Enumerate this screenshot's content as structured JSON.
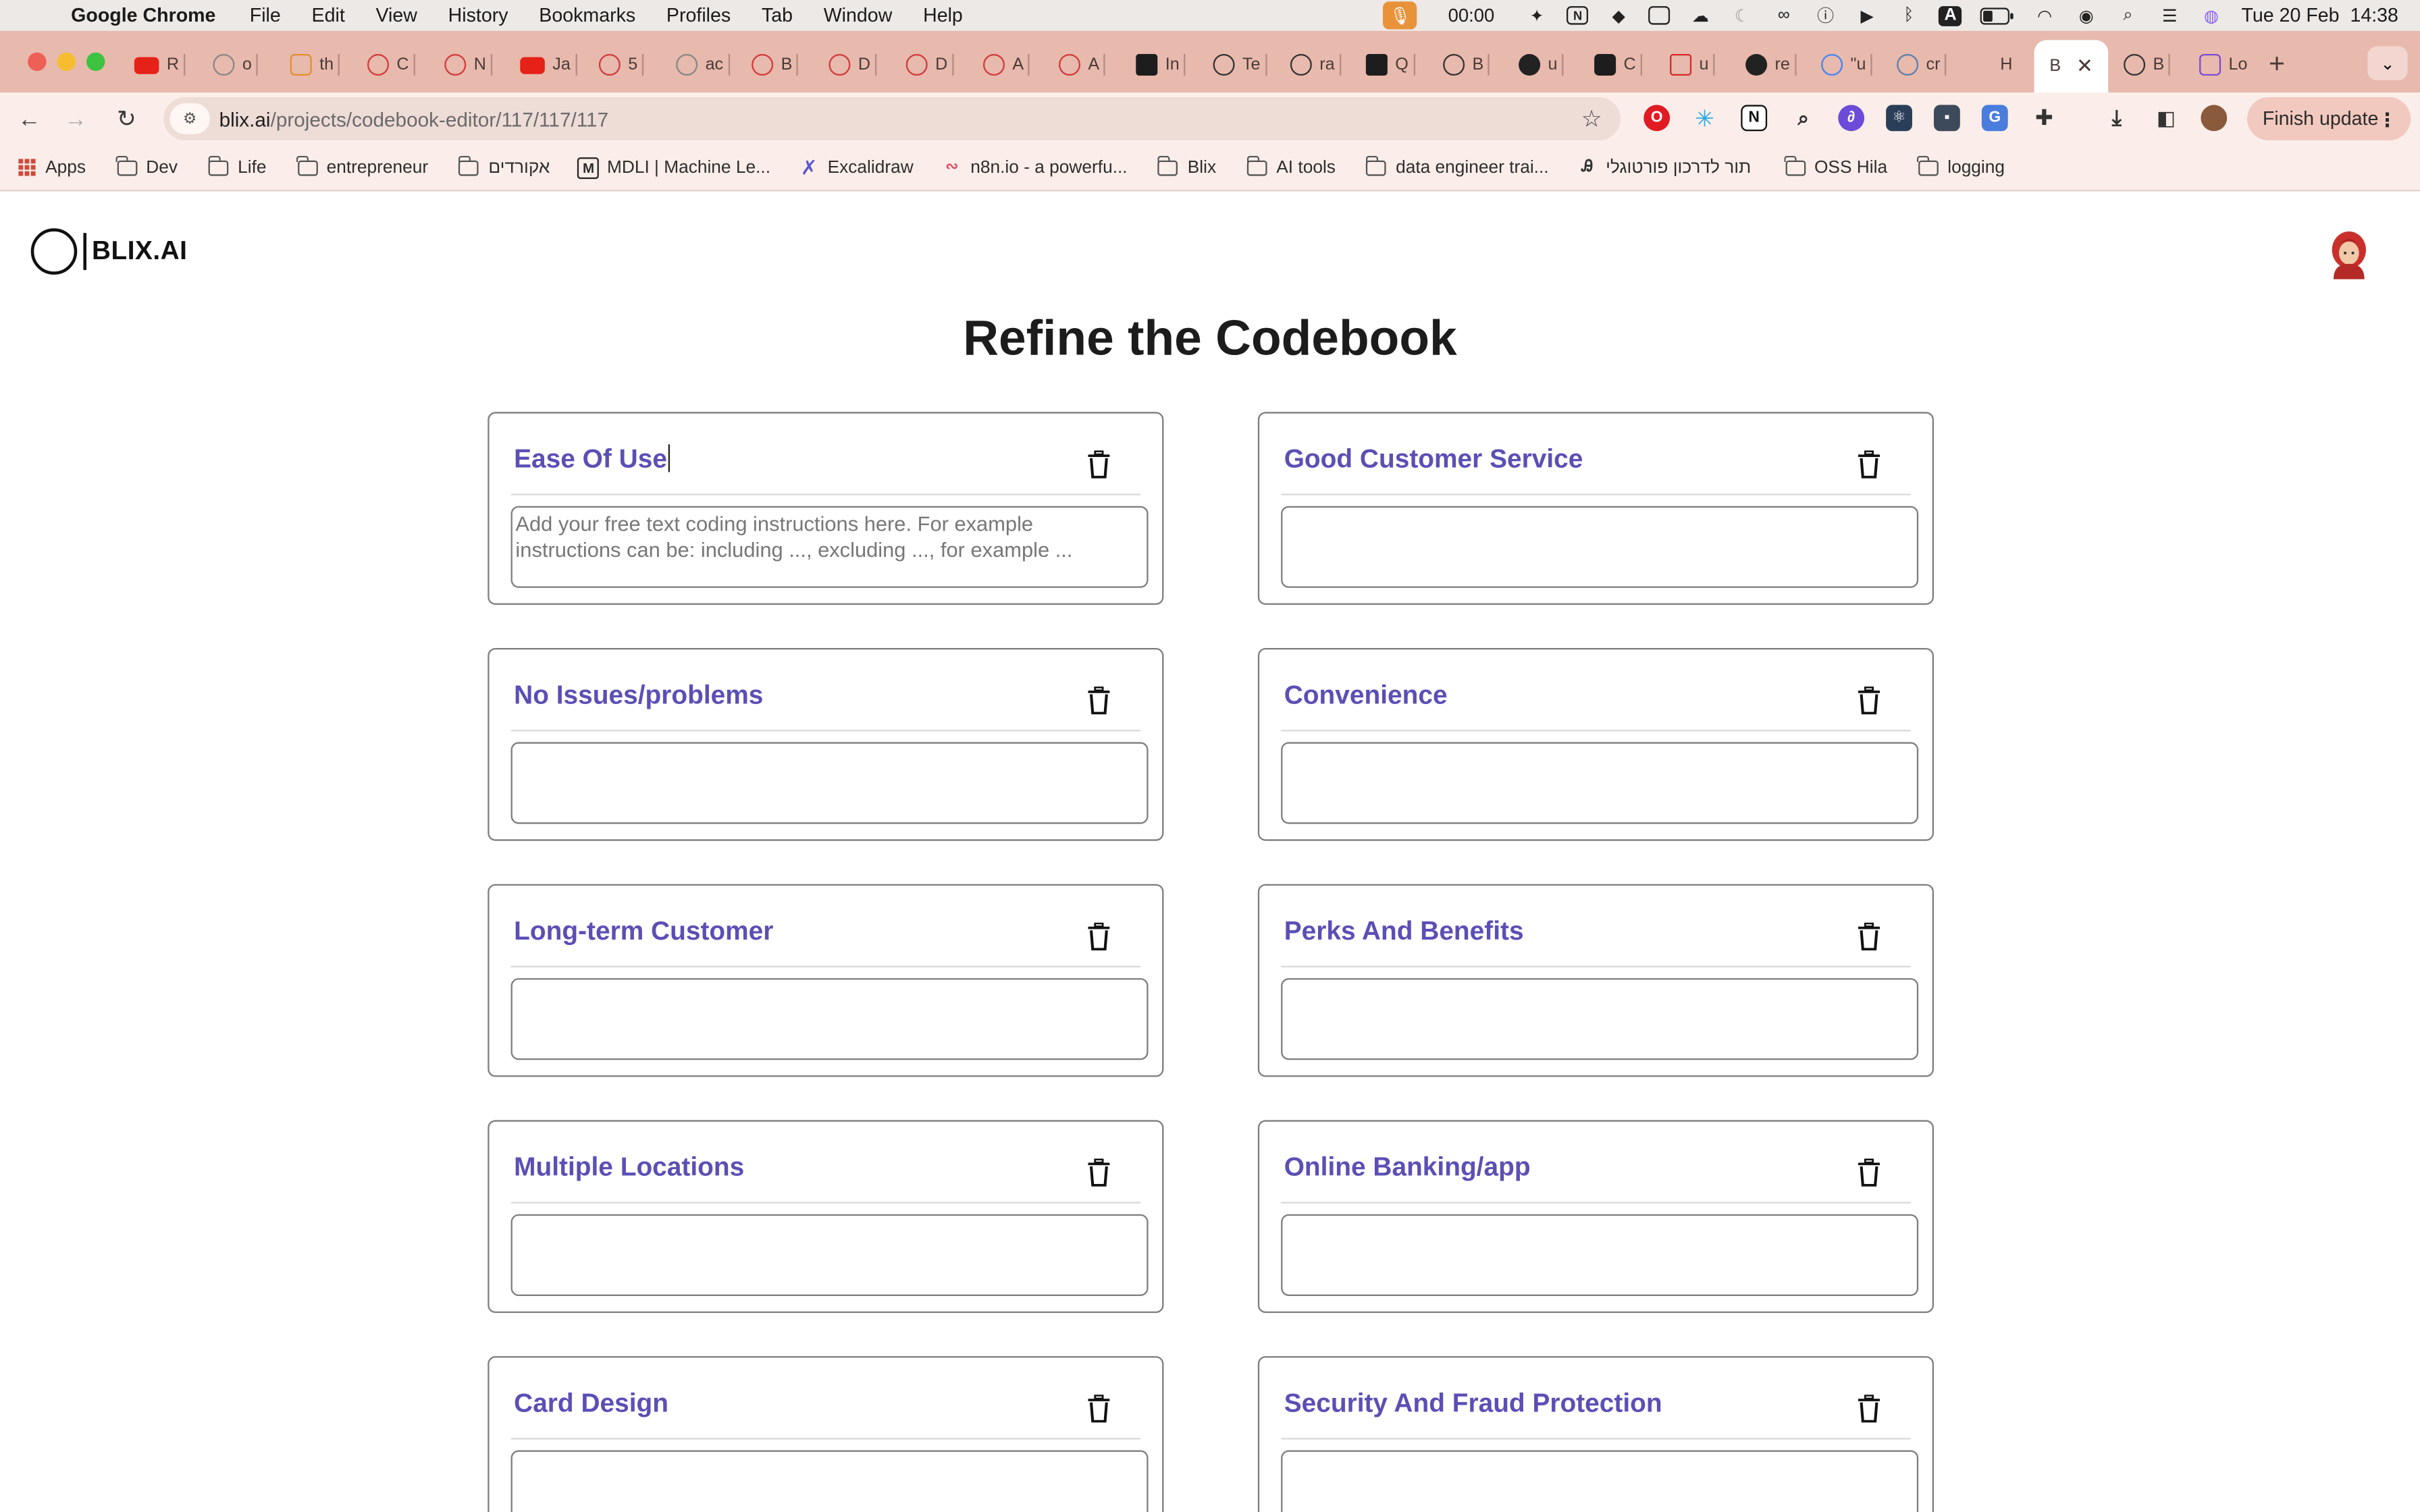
{
  "menubar": {
    "app_name": "Google Chrome",
    "items": [
      "File",
      "Edit",
      "View",
      "History",
      "Bookmarks",
      "Profiles",
      "Tab",
      "Window",
      "Help"
    ],
    "timer": "00:00",
    "datetime": "Tue 20 Feb  14:38"
  },
  "tabs": {
    "items": [
      "R",
      "o",
      "th",
      "C",
      "N",
      "Ja",
      "5",
      "ac",
      "B",
      "D",
      "D",
      "A",
      "A",
      "In",
      "Te",
      "ra",
      "Q",
      "B",
      "u",
      "C",
      "u",
      "re",
      "\"u",
      "cr",
      "H"
    ],
    "active_label": "B",
    "after_active": [
      "B",
      "Lo"
    ],
    "new_tab": "+"
  },
  "toolbar": {
    "url_domain": "blix.ai",
    "url_path": "/projects/codebook-editor/117/117/117",
    "finish_update": "Finish update"
  },
  "bookmarks": [
    "Apps",
    "Dev",
    "Life",
    "entrepreneur",
    "אקורדים",
    "MDLI | Machine Le...",
    "Excalidraw",
    "n8n.io - a powerfu...",
    "Blix",
    "AI tools",
    "data engineer trai...",
    "תור לדרכון פורטוגלי",
    "OSS Hila",
    "logging"
  ],
  "page": {
    "logo_text": "BLIX.AI",
    "title": "Refine the Codebook",
    "instructions_placeholder": "Add your free text coding instructions here. For example instructions can be: including ..., excluding ..., for example ...",
    "codes": [
      {
        "name": "Ease Of Use",
        "focused": true
      },
      {
        "name": "Good Customer Service"
      },
      {
        "name": "No Issues/problems"
      },
      {
        "name": "Convenience"
      },
      {
        "name": "Long-term Customer"
      },
      {
        "name": "Perks And Benefits"
      },
      {
        "name": "Multiple Locations"
      },
      {
        "name": "Online Banking/app"
      },
      {
        "name": "Card Design"
      },
      {
        "name": "Security And Fraud Protection"
      }
    ]
  },
  "colors": {
    "code_name": "#5b4fb5",
    "tabstrip": "#e8b9ad",
    "toolbar": "#fbeeea"
  }
}
